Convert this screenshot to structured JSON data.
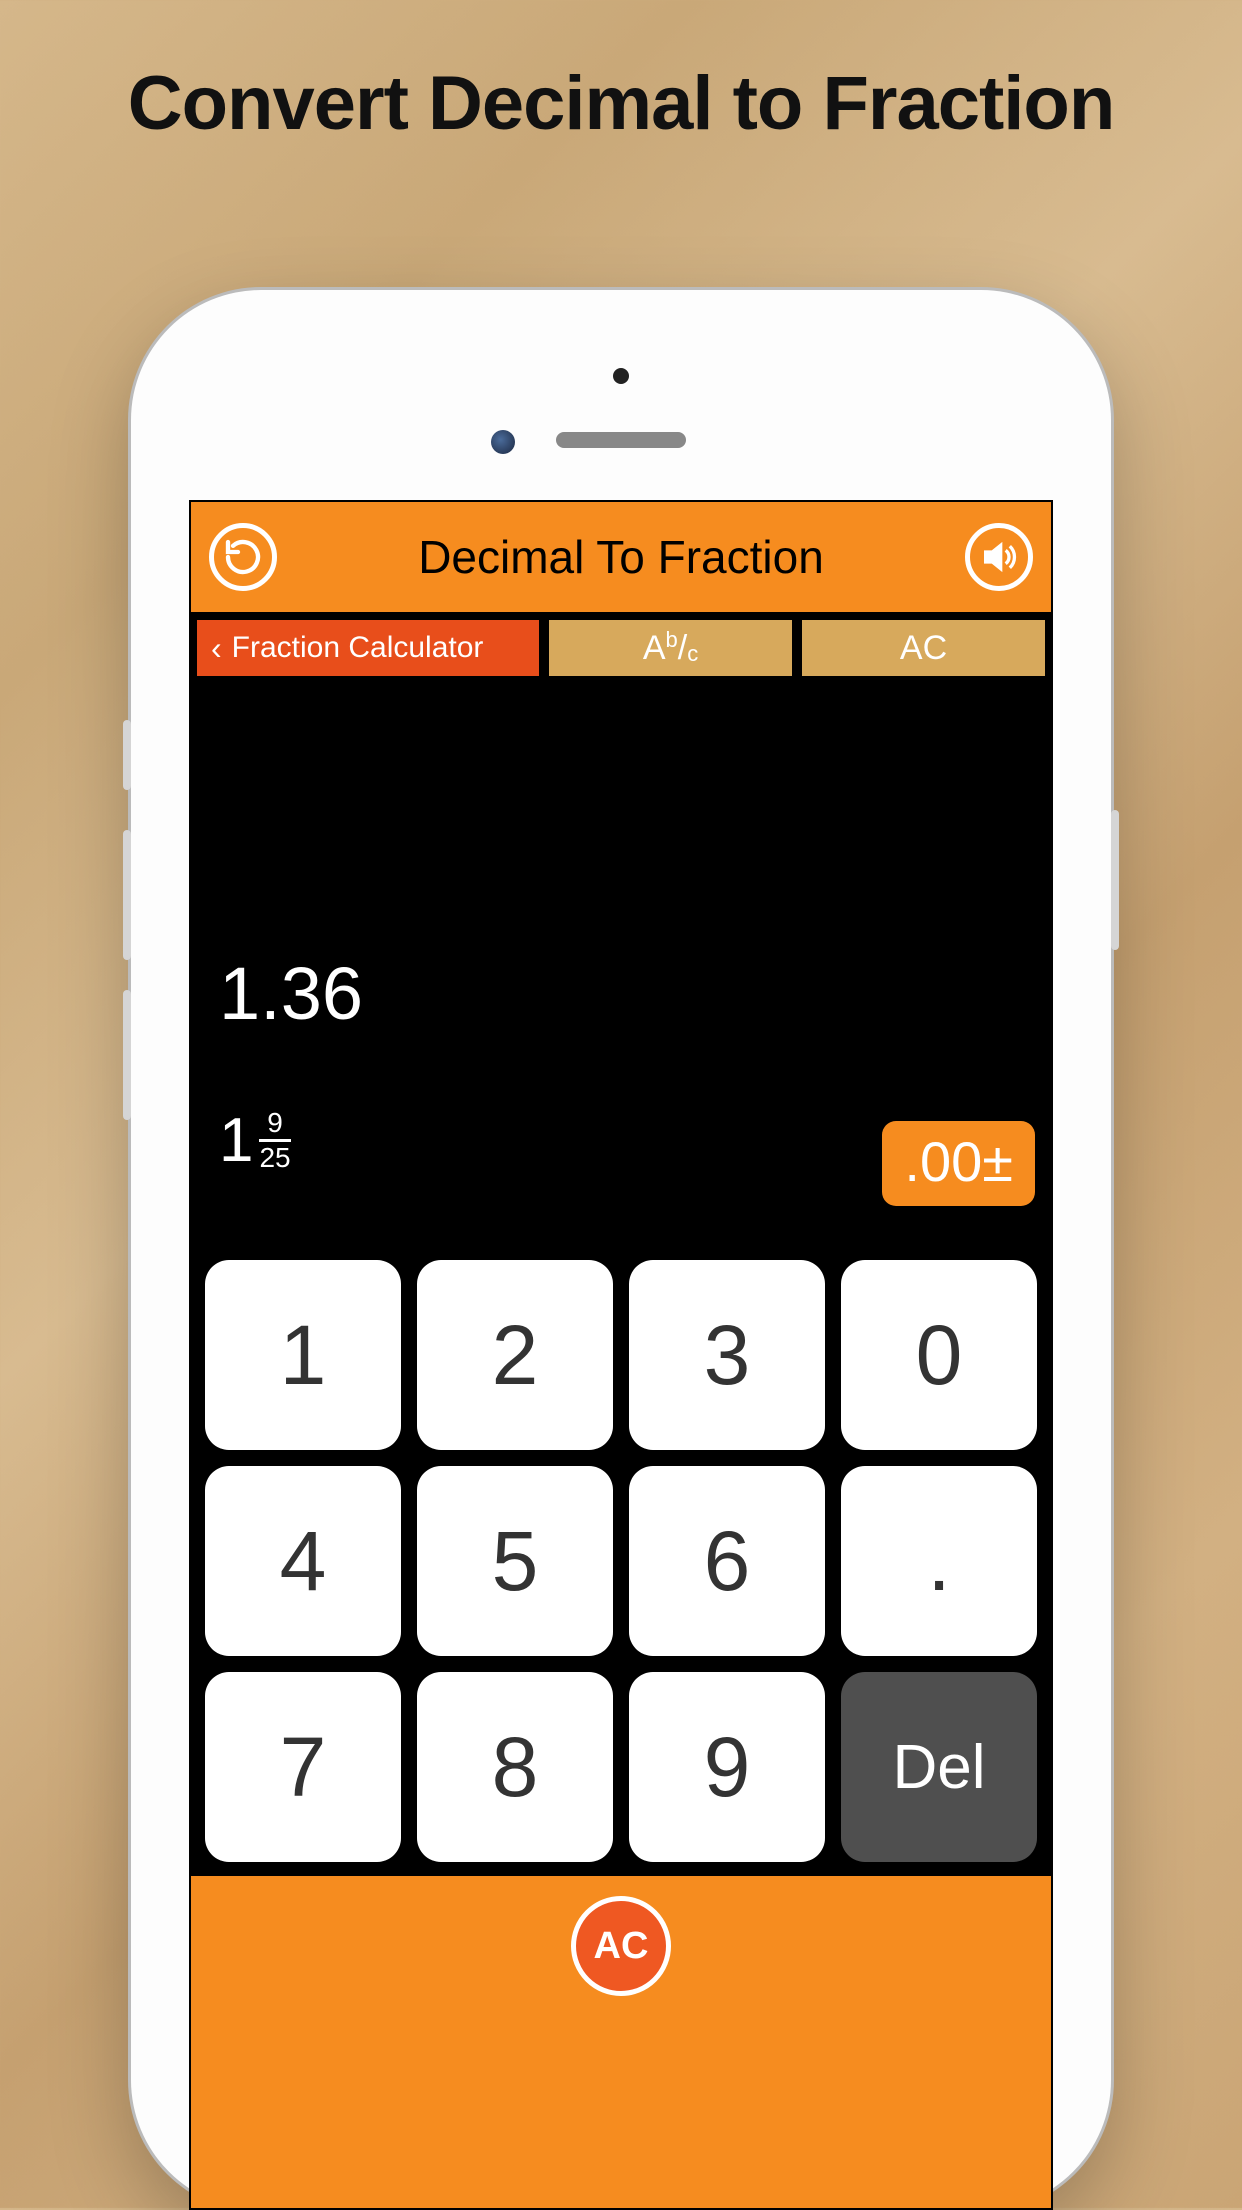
{
  "marketing": {
    "title": "Convert Decimal to Fraction"
  },
  "header": {
    "title": "Decimal To Fraction"
  },
  "subnav": {
    "back_label": "Fraction Calculator",
    "mode_A": "A",
    "mode_b": "b",
    "mode_slash": "/",
    "mode_c": "c",
    "ac_label": "AC"
  },
  "display": {
    "decimal": "1.36",
    "fraction": {
      "whole": "1",
      "numerator": "9",
      "denominator": "25"
    },
    "precision_label": ".00±"
  },
  "keypad": {
    "r0c0": "1",
    "r0c1": "2",
    "r0c2": "3",
    "r0c3": "0",
    "r1c0": "4",
    "r1c1": "5",
    "r1c2": "6",
    "r1c3": ".",
    "r2c0": "7",
    "r2c1": "8",
    "r2c2": "9",
    "r2c3": "Del"
  },
  "bottom": {
    "ac_label": "AC"
  }
}
